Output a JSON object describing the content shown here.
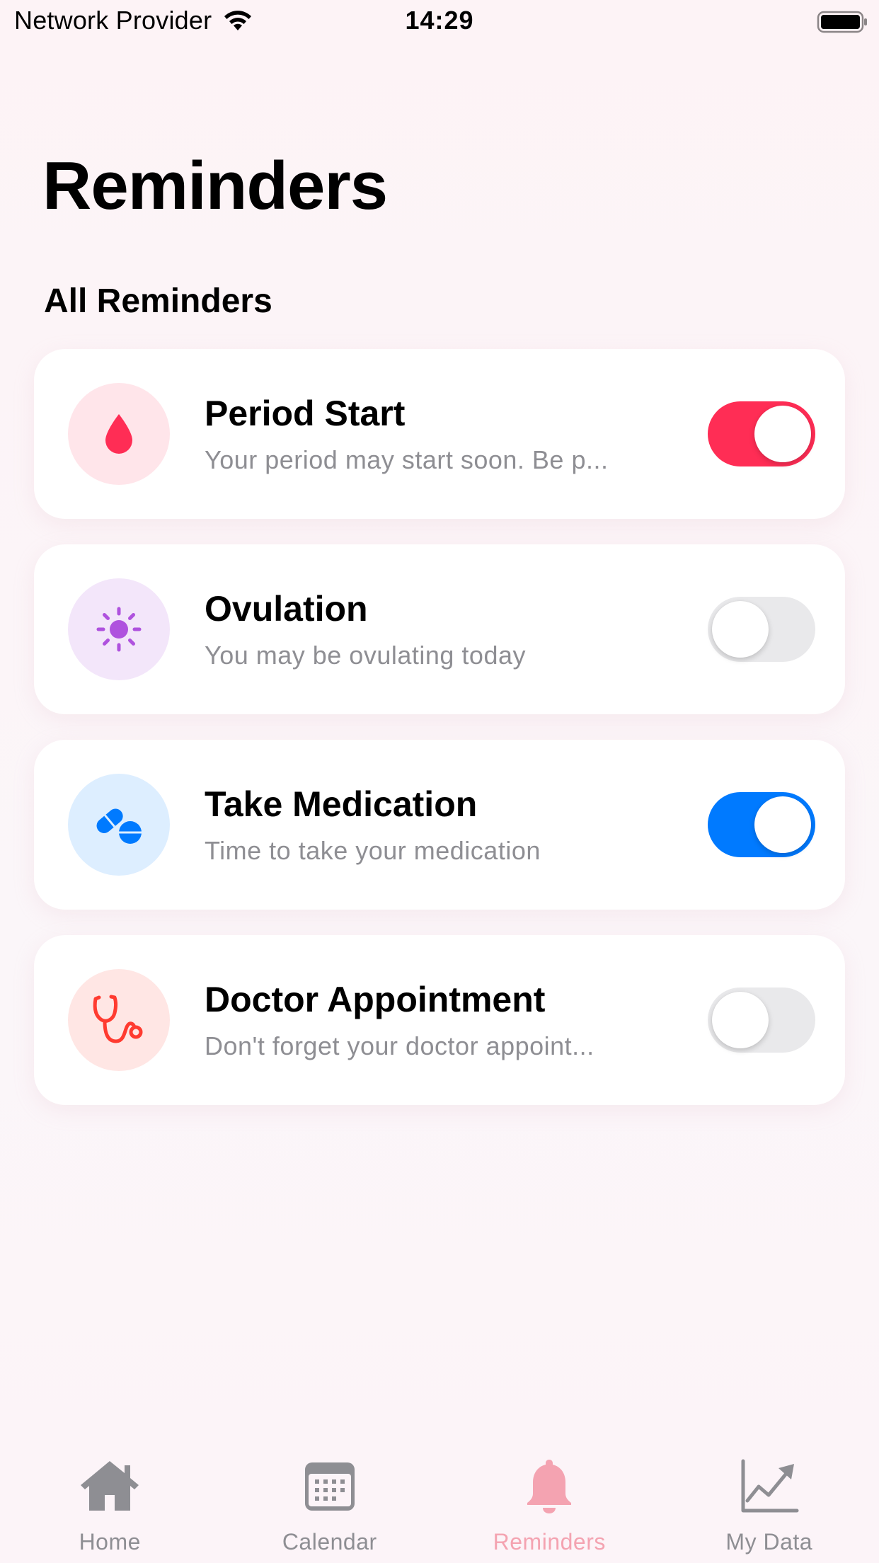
{
  "status_bar": {
    "carrier": "Network Provider",
    "time": "14:29"
  },
  "page": {
    "title": "Reminders",
    "section_title": "All Reminders"
  },
  "reminders": [
    {
      "title": "Period Start",
      "subtitle": "Your period may start soon. Be p...",
      "icon": "drop-icon",
      "enabled": true,
      "icon_color": "#ff2d55",
      "icon_bg": "#ffe5ea",
      "toggle_color": "#ff2d55"
    },
    {
      "title": "Ovulation",
      "subtitle": "You may be ovulating today",
      "icon": "sun-icon",
      "enabled": false,
      "icon_color": "#af52de",
      "icon_bg": "#f3e6fa"
    },
    {
      "title": "Take Medication",
      "subtitle": "Time to take your medication",
      "icon": "pills-icon",
      "enabled": true,
      "icon_color": "#007aff",
      "icon_bg": "#ddeeff",
      "toggle_color": "#007aff"
    },
    {
      "title": "Doctor Appointment",
      "subtitle": "Don't forget your doctor appoint...",
      "icon": "stethoscope-icon",
      "enabled": false,
      "icon_color": "#ff3b30",
      "icon_bg": "#ffe6e4"
    }
  ],
  "tab_bar": {
    "active_color": "#f4a3b1",
    "inactive_color": "#8e8e93",
    "tabs": [
      {
        "label": "Home",
        "icon": "house-icon",
        "active": false
      },
      {
        "label": "Calendar",
        "icon": "calendar-icon",
        "active": false
      },
      {
        "label": "Reminders",
        "icon": "bell-icon",
        "active": true
      },
      {
        "label": "My Data",
        "icon": "chart-icon",
        "active": false
      }
    ]
  }
}
